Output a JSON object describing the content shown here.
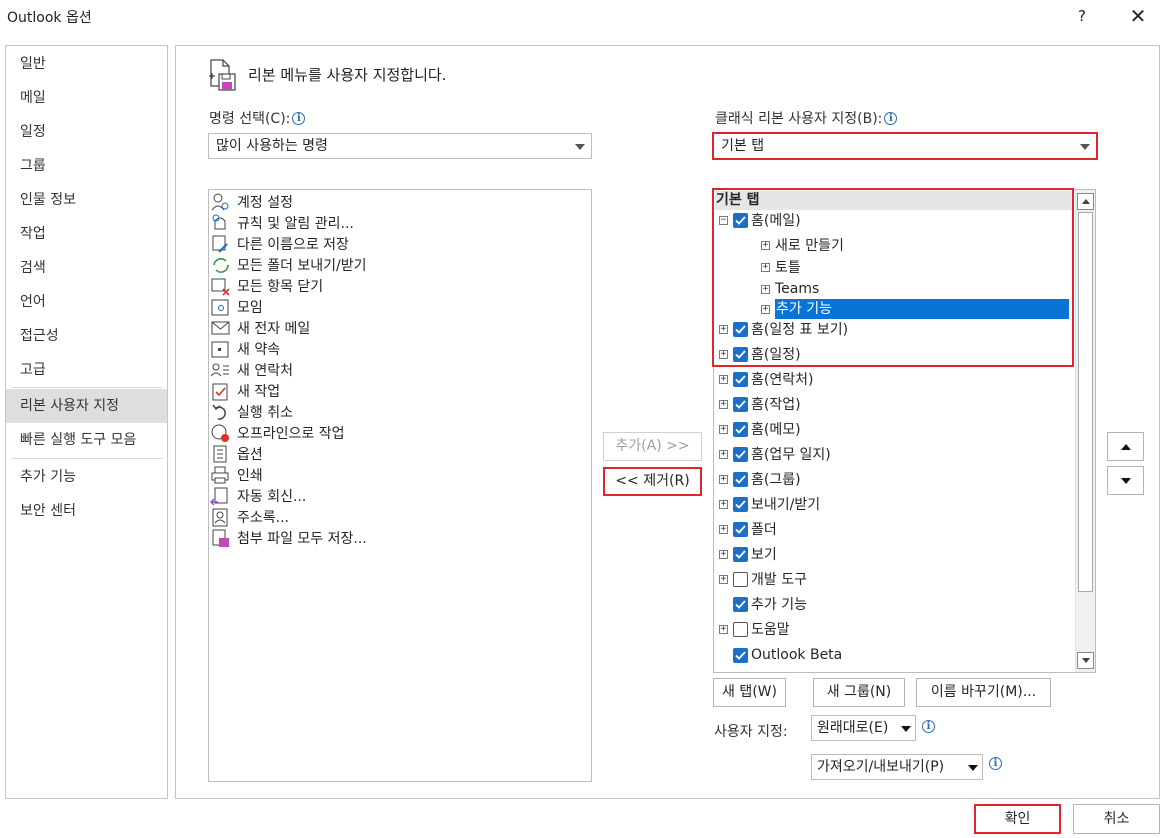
{
  "window": {
    "title": "Outlook 옵션",
    "help_label": "?",
    "close_label": "✕"
  },
  "nav": {
    "items": [
      {
        "label": "일반"
      },
      {
        "label": "메일"
      },
      {
        "label": "일정"
      },
      {
        "label": "그룹"
      },
      {
        "label": "인물 정보"
      },
      {
        "label": "작업"
      },
      {
        "label": "검색"
      },
      {
        "label": "언어"
      },
      {
        "label": "접근성"
      },
      {
        "label": "고급"
      },
      {
        "label": "리본 사용자 지정",
        "selected": true
      },
      {
        "label": "빠른 실행 도구 모음"
      },
      {
        "label": "추가 기능"
      },
      {
        "label": "보안 센터"
      }
    ]
  },
  "main": {
    "heading": "리본 메뉴를 사용자 지정합니다.",
    "choose_commands_label": "명령 선택(C):",
    "choose_commands_value": "많이 사용하는 명령",
    "customize_ribbon_label": "클래식 리본 사용자 지정(B):",
    "customize_ribbon_value": "기본 탭",
    "commands": [
      {
        "label": "계정 설정",
        "icon": "account-settings-icon"
      },
      {
        "label": "규칙 및 알림 관리...",
        "icon": "rules-alerts-icon"
      },
      {
        "label": "다른 이름으로 저장",
        "icon": "save-as-icon"
      },
      {
        "label": "모든 폴더 보내기/받기",
        "icon": "send-receive-icon"
      },
      {
        "label": "모든 항목 닫기",
        "icon": "close-all-icon"
      },
      {
        "label": "모임",
        "icon": "meeting-icon"
      },
      {
        "label": "새 전자 메일",
        "icon": "new-email-icon"
      },
      {
        "label": "새 약속",
        "icon": "new-appointment-icon"
      },
      {
        "label": "새 연락처",
        "icon": "new-contact-icon"
      },
      {
        "label": "새 작업",
        "icon": "new-task-icon"
      },
      {
        "label": "실행 취소",
        "icon": "undo-icon"
      },
      {
        "label": "오프라인으로 작업",
        "icon": "work-offline-icon"
      },
      {
        "label": "옵션",
        "icon": "options-icon"
      },
      {
        "label": "인쇄",
        "icon": "print-icon"
      },
      {
        "label": "자동 회신...",
        "icon": "auto-reply-icon"
      },
      {
        "label": "주소록...",
        "icon": "address-book-icon"
      },
      {
        "label": "첨부 파일 모두 저장...",
        "icon": "save-attachments-icon"
      }
    ],
    "add_button": "추가(A) >>",
    "remove_button": "<< 제거(R)",
    "tree_header": "기본 탭",
    "tree": [
      {
        "label": "홈(메일)",
        "expander": "⊟",
        "checked": true,
        "level": 0
      },
      {
        "label": "새로 만들기",
        "expander": "⊞",
        "checked": null,
        "level": 1
      },
      {
        "label": "토틀",
        "expander": "⊞",
        "checked": null,
        "level": 1
      },
      {
        "label": "Teams",
        "expander": "⊞",
        "checked": null,
        "level": 1
      },
      {
        "label": "추가 기능",
        "expander": "⊞",
        "checked": null,
        "level": 1,
        "selected": true
      },
      {
        "label": "홈(일정 표 보기)",
        "expander": "⊞",
        "checked": true,
        "level": 0
      },
      {
        "label": "홈(일정)",
        "expander": "⊞",
        "checked": true,
        "level": 0
      },
      {
        "label": "홈(연락처)",
        "expander": "⊞",
        "checked": true,
        "level": 0
      },
      {
        "label": "홈(작업)",
        "expander": "⊞",
        "checked": true,
        "level": 0
      },
      {
        "label": "홈(메모)",
        "expander": "⊞",
        "checked": true,
        "level": 0
      },
      {
        "label": "홈(업무 일지)",
        "expander": "⊞",
        "checked": true,
        "level": 0
      },
      {
        "label": "홈(그룹)",
        "expander": "⊞",
        "checked": true,
        "level": 0
      },
      {
        "label": "보내기/받기",
        "expander": "⊞",
        "checked": true,
        "level": 0
      },
      {
        "label": "폴더",
        "expander": "⊞",
        "checked": true,
        "level": 0
      },
      {
        "label": "보기",
        "expander": "⊞",
        "checked": true,
        "level": 0
      },
      {
        "label": "개발 도구",
        "expander": "⊞",
        "checked": false,
        "level": 0
      },
      {
        "label": "추가 기능",
        "expander": "",
        "checked": true,
        "level": 0
      },
      {
        "label": "도움말",
        "expander": "⊞",
        "checked": false,
        "level": 0
      },
      {
        "label": "Outlook Beta",
        "expander": "",
        "checked": true,
        "level": 0
      }
    ],
    "new_tab_button": "새 탭(W)",
    "new_group_button": "새 그룹(N)",
    "rename_button": "이름 바꾸기(M)...",
    "customizations_label": "사용자 지정:",
    "reset_value": "원래대로(E)",
    "import_export_value": "가져오기/내보내기(P)"
  },
  "footer": {
    "ok_button": "확인",
    "cancel_button": "취소"
  },
  "colors": {
    "accent": "#1e6fc8",
    "selection": "#0a74d6",
    "highlight_border": "#e0262c",
    "nav_selected": "#dedede"
  }
}
